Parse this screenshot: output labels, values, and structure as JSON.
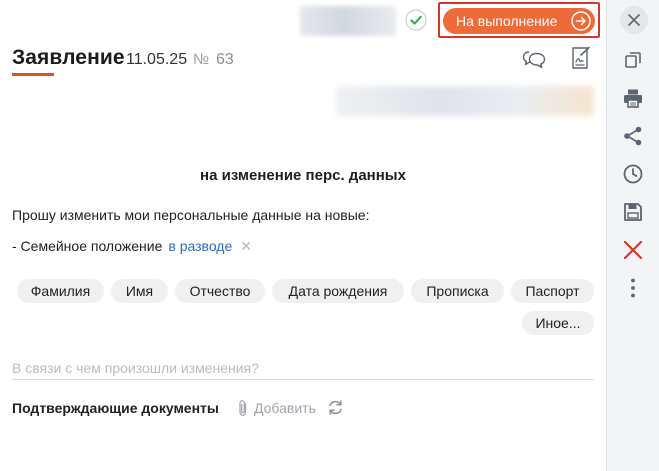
{
  "header": {
    "status_button_label": "На выполнение"
  },
  "document": {
    "title": "Заявление",
    "date": "11.05.25",
    "number_label": "№",
    "number": "63"
  },
  "body": {
    "subject": "на изменение перс. данных",
    "request_text": "Прошу изменить мои персональные данные на новые:",
    "change": {
      "field": "- Семейное положение",
      "value": "в разводе",
      "remove_glyph": "✕"
    },
    "chips": [
      "Фамилия",
      "Имя",
      "Отчество",
      "Дата рождения",
      "Прописка",
      "Паспорт",
      "Иное..."
    ],
    "reason_placeholder": "В связи с чем произошли изменения?",
    "documents_label": "Подтверждающие документы",
    "add_label": "Добавить"
  },
  "colors": {
    "accent": "#ed6a39",
    "highlight_border": "#d9362b",
    "link": "#2f6bbf",
    "delete": "#d9362b",
    "icon": "#5b6470"
  },
  "sidebar_icons": [
    "close-icon",
    "copy-icon",
    "printer-icon",
    "share-icon",
    "history-icon",
    "save-icon",
    "delete-icon",
    "more-icon"
  ]
}
